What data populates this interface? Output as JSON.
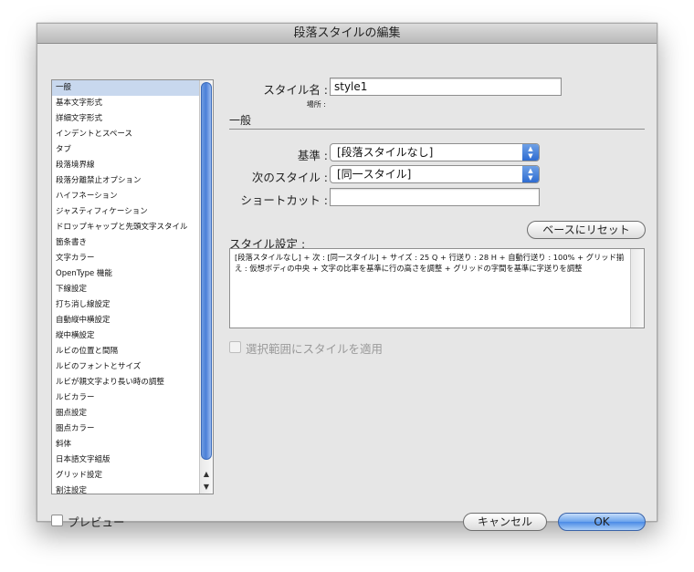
{
  "window": {
    "title": "段落スタイルの編集"
  },
  "sidebar": {
    "items": [
      "一般",
      "基本文字形式",
      "詳細文字形式",
      "インデントとスペース",
      "タブ",
      "段落境界線",
      "段落分離禁止オプション",
      "ハイフネーション",
      "ジャスティフィケーション",
      "ドロップキャップと先頭文字スタイル",
      "箇条書き",
      "文字カラー",
      "OpenType 機能",
      "下線設定",
      "打ち消し線設定",
      "自動縦中横設定",
      "縦中横設定",
      "ルビの位置と間隔",
      "ルビのフォントとサイズ",
      "ルビが親文字より長い時の調整",
      "ルビカラー",
      "圏点設定",
      "圏点カラー",
      "斜体",
      "日本語文字組版",
      "グリッド設定",
      "割注設定"
    ],
    "selected_index": 0
  },
  "form": {
    "style_name_label": "スタイル名 :",
    "style_name_value": "style1",
    "location_label": "場所 :",
    "section_heading": "一般",
    "based_on_label": "基準 :",
    "based_on_value": "[段落スタイルなし]",
    "next_style_label": "次のスタイル :",
    "next_style_value": "[同一スタイル]",
    "shortcut_label": "ショートカット :",
    "shortcut_value": "",
    "reset_button": "ベースにリセット",
    "style_settings_label": "スタイル設定 :",
    "style_settings_text": "[段落スタイルなし] + 次 : [同一スタイル] + サイズ : 25 Q + 行送り : 28 H + 自動行送り : 100% + グリッド揃え : 仮想ボディの中央 + 文字の比率を基準に行の高さを調整 + グリッドの字間を基準に字送りを調整",
    "apply_to_selection_label": "選択範囲にスタイルを適用"
  },
  "footer": {
    "preview_label": "プレビュー",
    "cancel_button": "キャンセル",
    "ok_button": "OK"
  },
  "colors": {
    "selection": "#c8d8ee",
    "accent_blue": "#4a8be6"
  },
  "icons": {
    "popup_arrows": "updown-arrows-icon",
    "scroll_up": "up-arrow-icon",
    "scroll_down": "down-arrow-icon"
  }
}
